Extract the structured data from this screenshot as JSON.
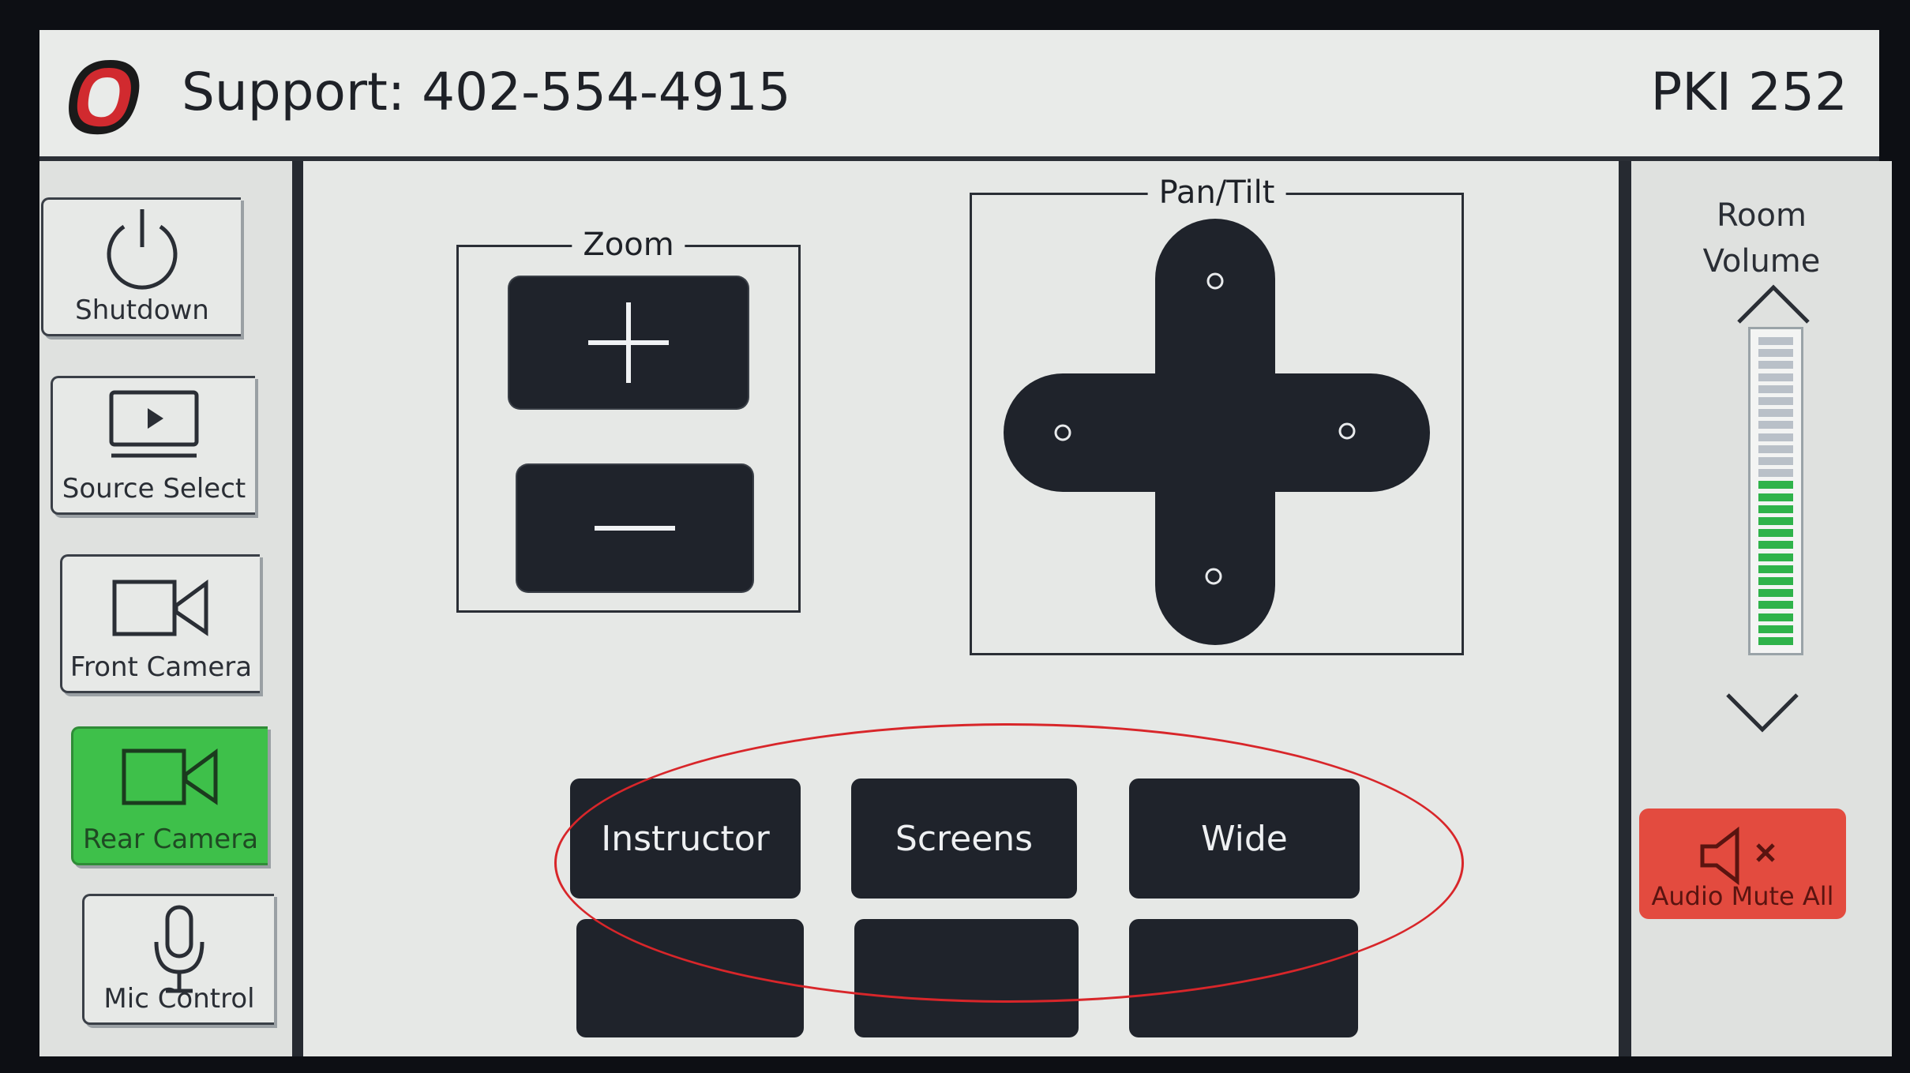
{
  "header": {
    "support_text": "Support: 402-554-4915",
    "room_name": "PKI 252",
    "logo_icon": "university-o-logo"
  },
  "sidebar": {
    "items": [
      {
        "label": "Shutdown",
        "icon": "power-icon",
        "active": false
      },
      {
        "label": "Source Select",
        "icon": "display-play-icon",
        "active": false
      },
      {
        "label": "Front Camera",
        "icon": "camera-icon",
        "active": false
      },
      {
        "label": "Rear Camera",
        "icon": "camera-icon",
        "active": true
      },
      {
        "label": "Mic Control",
        "icon": "microphone-icon",
        "active": false
      }
    ],
    "active_color": "#3ec04a"
  },
  "zoom": {
    "title": "Zoom",
    "in_icon": "plus-icon",
    "out_icon": "minus-icon"
  },
  "pantilt": {
    "title": "Pan/Tilt",
    "icon": "directional-pad-icon"
  },
  "presets": {
    "row1": [
      "Instructor",
      "Screens",
      "Wide"
    ],
    "row2": [
      "",
      "",
      ""
    ]
  },
  "volume": {
    "label_line1": "Room",
    "label_line2": "Volume",
    "up_icon": "chevron-up-icon",
    "down_icon": "chevron-down-icon",
    "level_fraction": 0.55,
    "meter_color": "#2fb34a"
  },
  "mute": {
    "label": "Audio Mute All",
    "icon": "speaker-mute-icon",
    "color": "#e34b3f"
  },
  "annotation": {
    "color": "#d8262a"
  }
}
